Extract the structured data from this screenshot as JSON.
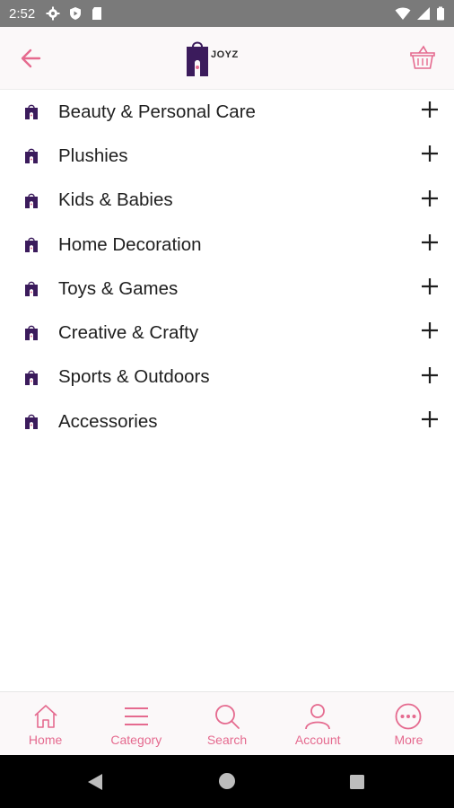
{
  "status_bar": {
    "time": "2:52",
    "left_icons": [
      "settings-icon",
      "shield-icon",
      "sd-card-icon"
    ],
    "right_icons": [
      "wifi-icon",
      "cellular-icon",
      "battery-icon"
    ]
  },
  "header": {
    "logo_text": "JOYZ",
    "back_icon": "back-arrow-icon",
    "basket_icon": "basket-icon"
  },
  "categories": [
    {
      "label": "Beauty & Personal Care"
    },
    {
      "label": "Plushies"
    },
    {
      "label": "Kids & Babies"
    },
    {
      "label": "Home Decoration"
    },
    {
      "label": "Toys & Games"
    },
    {
      "label": "Creative & Crafty"
    },
    {
      "label": "Sports & Outdoors"
    },
    {
      "label": "Accessories"
    }
  ],
  "bottom_nav": [
    {
      "label": "Home",
      "icon": "home-icon"
    },
    {
      "label": "Category",
      "icon": "menu-icon"
    },
    {
      "label": "Search",
      "icon": "search-icon"
    },
    {
      "label": "Account",
      "icon": "account-icon"
    },
    {
      "label": "More",
      "icon": "more-icon"
    }
  ],
  "colors": {
    "accent": "#e56a8f",
    "logo_purple": "#3b1b5c",
    "status_bar": "#7a7a7a",
    "header_bg": "#fbf8f9"
  }
}
